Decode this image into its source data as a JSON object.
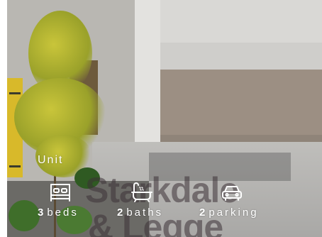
{
  "listing": {
    "property_type": "Unit",
    "features": {
      "beds": {
        "count": "3",
        "label": "beds",
        "icon": "bed-icon"
      },
      "baths": {
        "count": "2",
        "label": "baths",
        "icon": "bathtub-icon"
      },
      "parking": {
        "count": "2",
        "label": "parking",
        "icon": "car-icon"
      }
    }
  },
  "watermark": {
    "line1": "Starkdale",
    "line2": "& Legge"
  },
  "colors": {
    "text": "#ffffff",
    "watermark_accent": "#c8323c"
  }
}
